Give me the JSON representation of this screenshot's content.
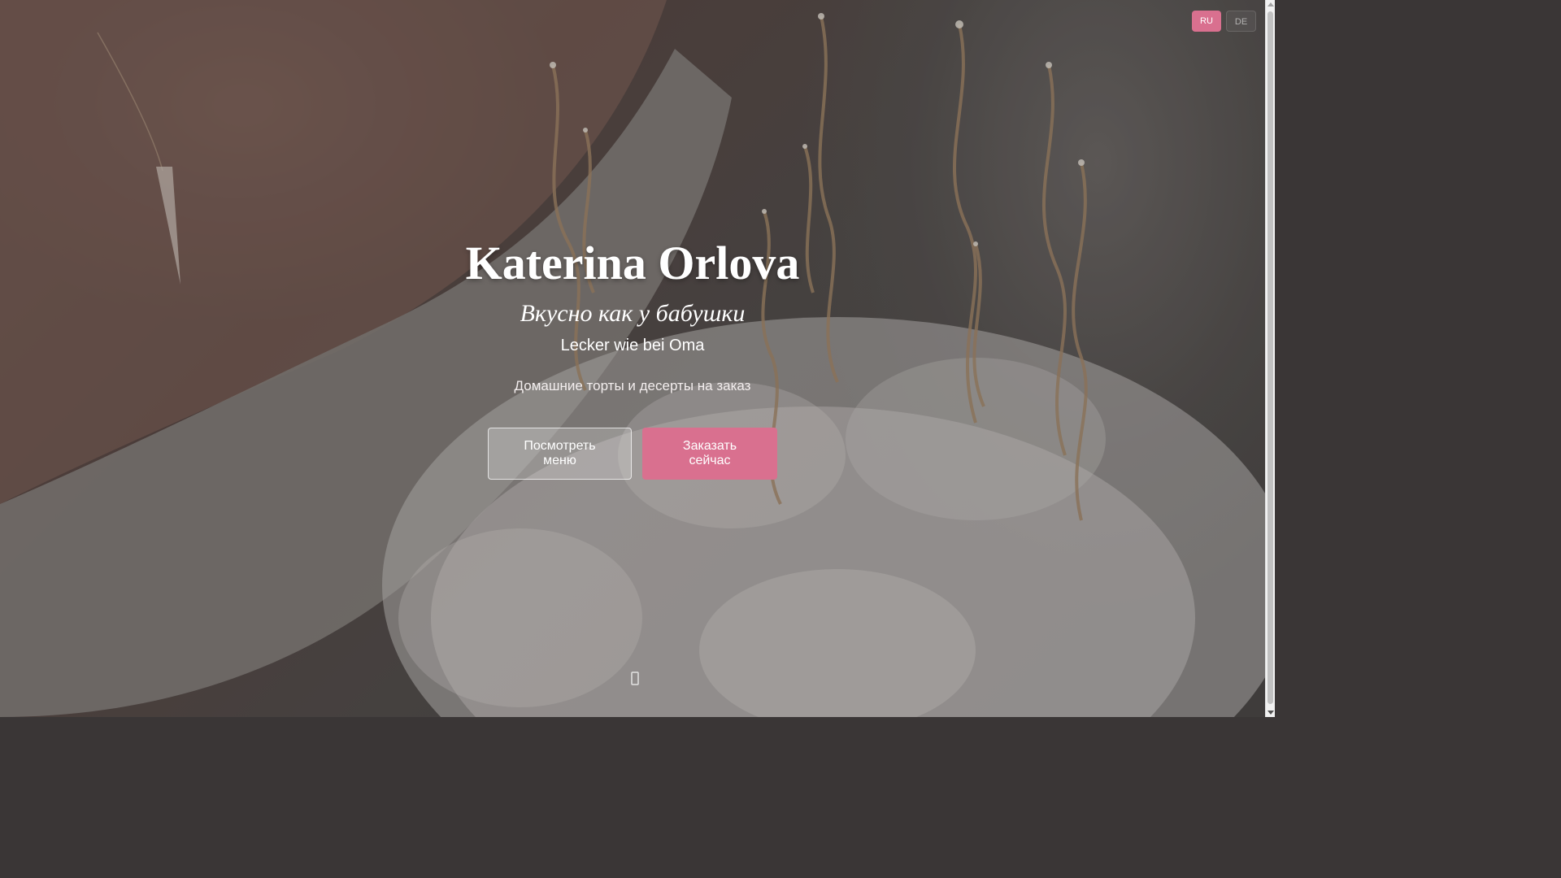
{
  "language_switch": {
    "active": "RU",
    "inactive": "DE"
  },
  "hero": {
    "title": "Katerina Orlova",
    "tagline_ru": "Вкусно как у бабушки",
    "tagline_de": "Lecker wie bei Oma",
    "subtitle": "Домашние торты и десерты на заказ",
    "buttons": {
      "menu": "Посмотреть меню",
      "order": "Заказать сейчас"
    },
    "scroll_icon": "chevron-down-icon"
  },
  "colors": {
    "accent": "#d9708f"
  }
}
